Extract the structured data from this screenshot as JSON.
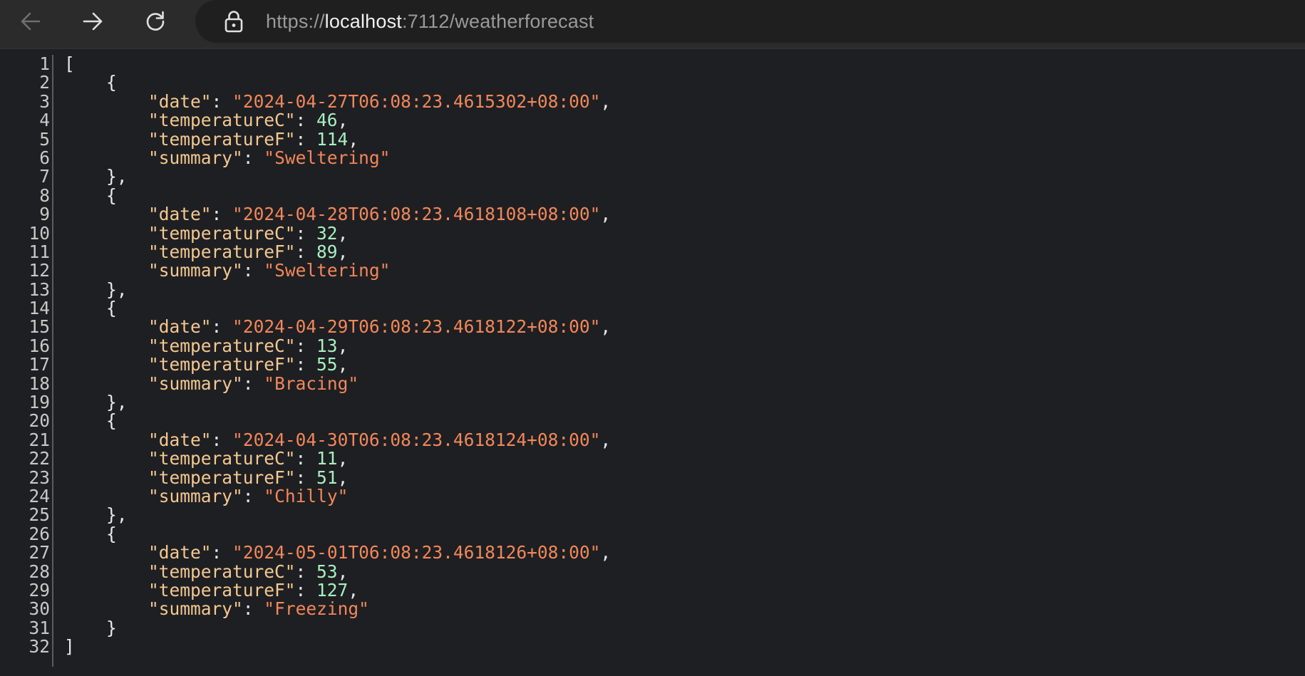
{
  "browser": {
    "url_scheme": "https://",
    "url_host": "localhost",
    "url_path": ":7112/weatherforecast",
    "icons": {
      "back": "arrow-left-icon",
      "forward": "arrow-right-icon",
      "reload": "refresh-icon",
      "security": "lock-icon"
    }
  },
  "json_viewer": {
    "forecasts": [
      {
        "date": "2024-04-27T06:08:23.4615302+08:00",
        "temperatureC": "46",
        "temperatureF": "114",
        "summary": "Sweltering"
      },
      {
        "date": "2024-04-28T06:08:23.4618108+08:00",
        "temperatureC": "32",
        "temperatureF": "89",
        "summary": "Sweltering"
      },
      {
        "date": "2024-04-29T06:08:23.4618122+08:00",
        "temperatureC": "13",
        "temperatureF": "55",
        "summary": "Bracing"
      },
      {
        "date": "2024-04-30T06:08:23.4618124+08:00",
        "temperatureC": "11",
        "temperatureF": "51",
        "summary": "Chilly"
      },
      {
        "date": "2024-05-01T06:08:23.4618126+08:00",
        "temperatureC": "53",
        "temperatureF": "127",
        "summary": "Freezing"
      }
    ],
    "line_numbers": [
      "1",
      "2",
      "3",
      "4",
      "5",
      "6",
      "7",
      "8",
      "9",
      "10",
      "11",
      "12",
      "13",
      "14",
      "15",
      "16",
      "17",
      "18",
      "19",
      "20",
      "21",
      "22",
      "23",
      "24",
      "25",
      "26",
      "27",
      "28",
      "29",
      "30",
      "31",
      "32"
    ],
    "colors": {
      "key": "#f4c891",
      "string": "#f2875a",
      "number": "#a8f0c0",
      "background": "#1e1f22"
    }
  }
}
